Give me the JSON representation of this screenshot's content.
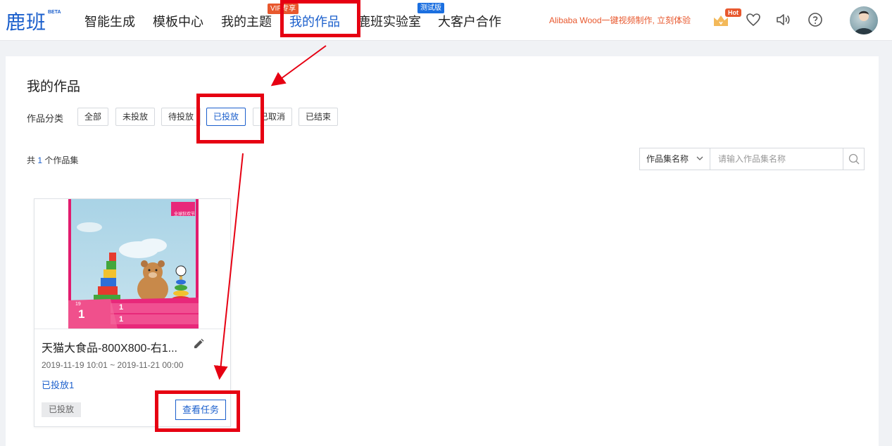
{
  "header": {
    "logo": "鹿班",
    "logo_badge": "BETA",
    "nav": [
      {
        "label": "智能生成"
      },
      {
        "label": "模板中心"
      },
      {
        "label": "我的主题",
        "badge": "VIP专享"
      },
      {
        "label": "我的作品",
        "active": true
      },
      {
        "label": "鹿班实验室",
        "badge": "测试版"
      },
      {
        "label": "大客户合作"
      }
    ],
    "promo": "Alibaba Wood一键视频制作, 立刻体验",
    "hot_badge": "Hot",
    "icons": [
      "crown-icon",
      "heart-icon",
      "speaker-icon",
      "help-icon",
      "avatar"
    ]
  },
  "main": {
    "title": "我的作品",
    "filter_label": "作品分类",
    "filters": [
      "全部",
      "未投放",
      "待投放",
      "已投放",
      "已取消",
      "已结束"
    ],
    "selected_filter": "已投放",
    "count_prefix": "共",
    "count": "1",
    "count_suffix": "个作品集",
    "search": {
      "select_value": "作品集名称",
      "placeholder": "请输入作品集名称"
    }
  },
  "card": {
    "title": "天猫大食品-800X800-右1...",
    "date_range": "2019-11-19 10:01 ~ 2019-11-21 00:00",
    "link": "已投放1",
    "status": "已投放",
    "action": "查看任务",
    "thumb_price": "1",
    "thumb_row1": "1",
    "thumb_row2": "1",
    "thumb_corner": "全球狂欢节",
    "thumb_small": "19"
  },
  "colors": {
    "brand": "#1b5fcc",
    "promo": "#e8582e",
    "annotation": "#e60012"
  }
}
